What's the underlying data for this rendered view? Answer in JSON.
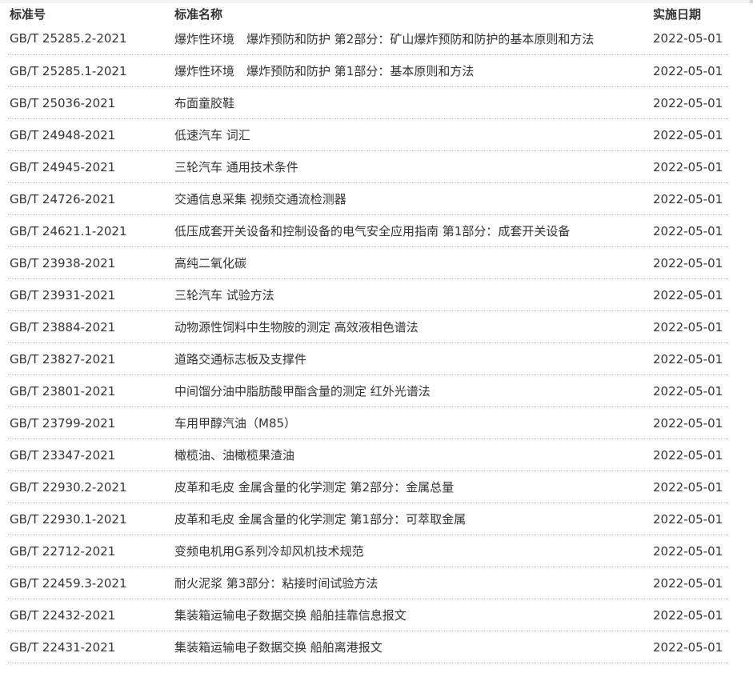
{
  "table": {
    "headers": {
      "code": "标准号",
      "name": "标准名称",
      "date": "实施日期"
    },
    "rows": [
      {
        "code": "GB/T 25285.2-2021",
        "name": "爆炸性环境　爆炸预防和防护 第2部分：矿山爆炸预防和防护的基本原则和方法",
        "date": "2022-05-01"
      },
      {
        "code": "GB/T 25285.1-2021",
        "name": "爆炸性环境　爆炸预防和防护 第1部分：基本原则和方法",
        "date": "2022-05-01"
      },
      {
        "code": "GB/T 25036-2021",
        "name": "布面童胶鞋",
        "date": "2022-05-01"
      },
      {
        "code": "GB/T 24948-2021",
        "name": "低速汽车 词汇",
        "date": "2022-05-01"
      },
      {
        "code": "GB/T 24945-2021",
        "name": "三轮汽车 通用技术条件",
        "date": "2022-05-01"
      },
      {
        "code": "GB/T 24726-2021",
        "name": "交通信息采集 视频交通流检测器",
        "date": "2022-05-01"
      },
      {
        "code": "GB/T 24621.1-2021",
        "name": "低压成套开关设备和控制设备的电气安全应用指南 第1部分：成套开关设备",
        "date": "2022-05-01"
      },
      {
        "code": "GB/T 23938-2021",
        "name": "高纯二氧化碳",
        "date": "2022-05-01"
      },
      {
        "code": "GB/T 23931-2021",
        "name": "三轮汽车 试验方法",
        "date": "2022-05-01"
      },
      {
        "code": "GB/T 23884-2021",
        "name": "动物源性饲料中生物胺的测定 高效液相色谱法",
        "date": "2022-05-01"
      },
      {
        "code": "GB/T 23827-2021",
        "name": "道路交通标志板及支撑件",
        "date": "2022-05-01"
      },
      {
        "code": "GB/T 23801-2021",
        "name": "中间馏分油中脂肪酸甲酯含量的测定 红外光谱法",
        "date": "2022-05-01"
      },
      {
        "code": "GB/T 23799-2021",
        "name": "车用甲醇汽油（M85）",
        "date": "2022-05-01"
      },
      {
        "code": "GB/T 23347-2021",
        "name": "橄榄油、油橄榄果渣油",
        "date": "2022-05-01"
      },
      {
        "code": "GB/T 22930.2-2021",
        "name": "皮革和毛皮 金属含量的化学测定 第2部分：金属总量",
        "date": "2022-05-01"
      },
      {
        "code": "GB/T 22930.1-2021",
        "name": "皮革和毛皮 金属含量的化学测定 第1部分：可萃取金属",
        "date": "2022-05-01"
      },
      {
        "code": "GB/T 22712-2021",
        "name": "变频电机用G系列冷却风机技术规范",
        "date": "2022-05-01"
      },
      {
        "code": "GB/T 22459.3-2021",
        "name": "耐火泥浆 第3部分：粘接时间试验方法",
        "date": "2022-05-01"
      },
      {
        "code": "GB/T 22432-2021",
        "name": "集装箱运输电子数据交换 船舶挂靠信息报文",
        "date": "2022-05-01"
      },
      {
        "code": "GB/T 22431-2021",
        "name": "集装箱运输电子数据交换 船舶离港报文",
        "date": "2022-05-01"
      }
    ]
  }
}
